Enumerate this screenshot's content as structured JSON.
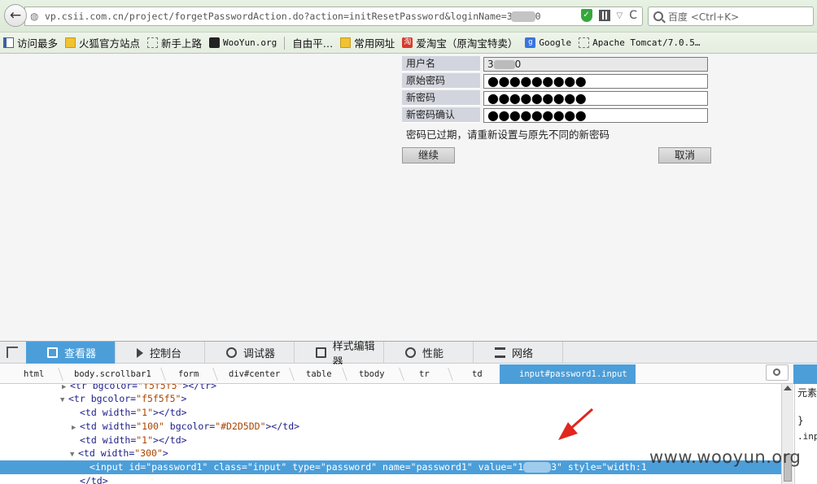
{
  "browser": {
    "url": "vp.csii.com.cn/project/forgetPasswordAction.do?action=initResetPassword&loginName=3",
    "url_tail": "0",
    "search_placeholder": "百度 <Ctrl+K>"
  },
  "bookmarks": [
    {
      "label": "访问最多",
      "icon": "bookmark-icon"
    },
    {
      "label": "火狐官方站点",
      "icon": "folder-icon"
    },
    {
      "label": "新手上路",
      "icon": "page-icon"
    },
    {
      "label": "WooYun.org",
      "icon": "wooyun-icon"
    },
    {
      "label": "自由平…",
      "icon": "none"
    },
    {
      "label": "常用网址",
      "icon": "folder-icon"
    },
    {
      "label": "爱淘宝（原淘宝特卖）",
      "icon": "taobao-icon"
    },
    {
      "label": "Google",
      "icon": "google-icon"
    },
    {
      "label": "Apache Tomcat/7.0.5…",
      "icon": "page-icon"
    }
  ],
  "form": {
    "rows": [
      {
        "label": "用户名",
        "value_start": "3",
        "value_end": "0"
      },
      {
        "label": "原始密码",
        "dots": "●●●●●●●●●"
      },
      {
        "label": "新密码",
        "dots": "●●●●●●●●●"
      },
      {
        "label": "新密码确认",
        "dots": "●●●●●●●●●"
      }
    ],
    "notice": "密码已过期，请重新设置与原先不同的新密码",
    "continue_label": "继续",
    "cancel_label": "取消"
  },
  "devtools": {
    "tabs": [
      "查看器",
      "控制台",
      "调试器",
      "样式编辑器",
      "性能",
      "网络"
    ],
    "breadcrumbs": [
      "html",
      "body.scrollbar1",
      "form",
      "div#center",
      "table",
      "tbody",
      "tr",
      "td",
      "input#password1.input"
    ],
    "markup": {
      "l0": {
        "tag_open": "<tr",
        "attr": " bgcolor=",
        "val": "\"f5f5f5\"",
        "close": "></tr>"
      },
      "l1": {
        "tag_open": "<tr",
        "attr": " bgcolor=",
        "val": "\"f5f5f5\"",
        "close": ">"
      },
      "l2": {
        "tag_open": "<td",
        "attr": " width=",
        "val": "\"1\"",
        "close": "></td>"
      },
      "l3": {
        "tag_open": "<td",
        "attr": " width=",
        "val": "\"100\"",
        "attr2": " bgcolor=",
        "val2": "\"#D2D5DD\"",
        "close": "></td>"
      },
      "l4": {
        "tag_open": "<td",
        "attr": " width=",
        "val": "\"1\"",
        "close": "></td>"
      },
      "l5": {
        "tag_open": "<td",
        "attr": " width=",
        "val": "\"300\"",
        "close": ">"
      },
      "l6": {
        "text_a": "<input id=\"password1\" class=\"input\" type=\"password\" name=\"password1\" value=\"1",
        "text_b": "3\" style=\"width:1"
      },
      "l7": {
        "text": "</td>"
      }
    },
    "rules": {
      "line1": "元素",
      "line2": "}",
      "line3": ".inp"
    }
  },
  "watermark": "www.wooyun.org",
  "colors": {
    "accent": "#4c9ed9",
    "label_bg": "#d2d5dd",
    "arrow": "#e0261e"
  }
}
